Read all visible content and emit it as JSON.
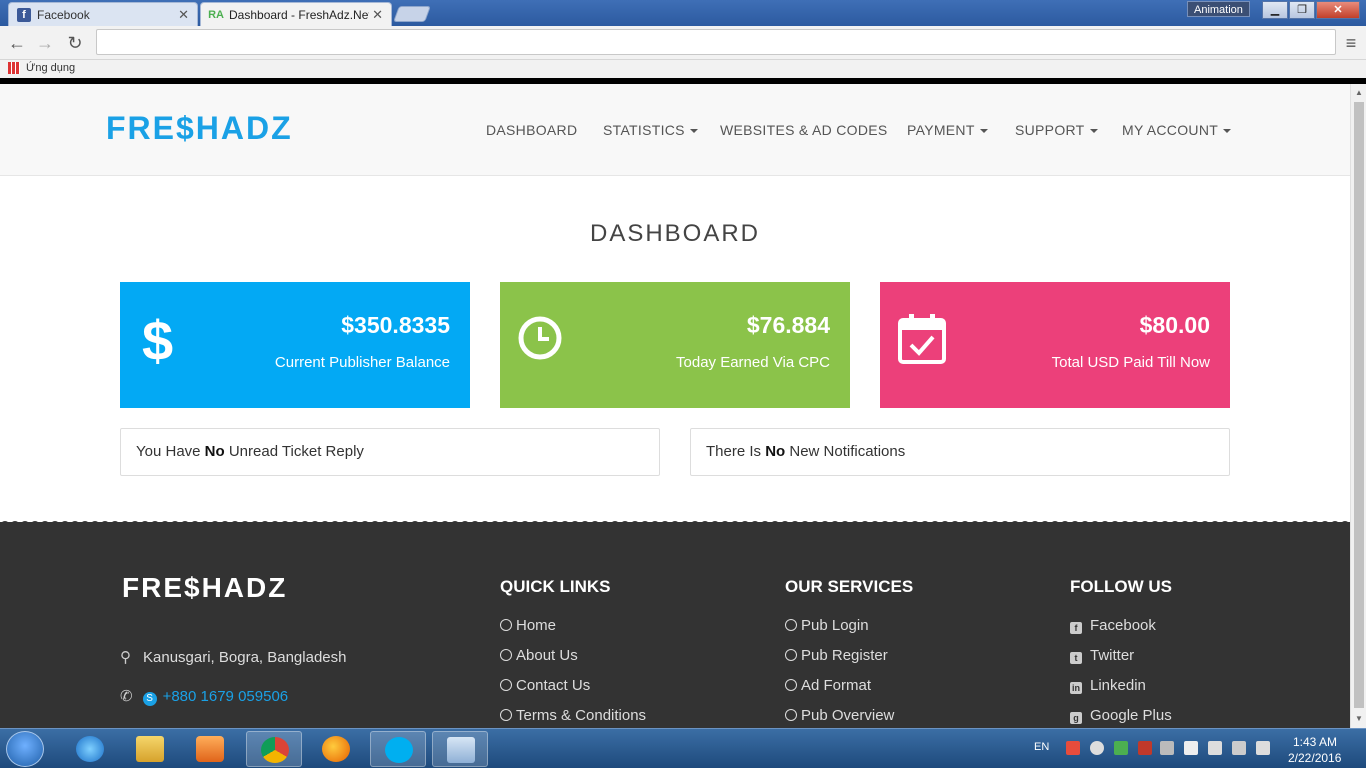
{
  "browser": {
    "tabs": [
      {
        "label": "Facebook",
        "active": false
      },
      {
        "label": "Dashboard - FreshAdz.Net",
        "active": true
      }
    ],
    "animation_badge": "Animation",
    "bookmarks_first": "Ứng dụng"
  },
  "site": {
    "logo": "FRE$HADZ",
    "nav": [
      {
        "label": "DASHBOARD",
        "dropdown": false
      },
      {
        "label": "STATISTICS",
        "dropdown": true
      },
      {
        "label": "WEBSITES & AD CODES",
        "dropdown": false
      },
      {
        "label": "PAYMENT",
        "dropdown": true
      },
      {
        "label": "SUPPORT",
        "dropdown": true
      },
      {
        "label": "MY ACCOUNT",
        "dropdown": true
      }
    ],
    "page_title": "DASHBOARD",
    "cards": [
      {
        "value": "$350.8335",
        "label": "Current Publisher Balance",
        "color": "#03a9f4",
        "icon": "dollar-icon"
      },
      {
        "value": "$76.884",
        "label": "Today Earned Via CPC",
        "color": "#8bc34a",
        "icon": "clock-icon"
      },
      {
        "value": "$80.00",
        "label": "Total USD Paid Till Now",
        "color": "#ec407a",
        "icon": "calendar-check-icon"
      }
    ],
    "notices": [
      {
        "pre": "You Have ",
        "bold": "No",
        "post": " Unread Ticket Reply"
      },
      {
        "pre": "There Is ",
        "bold": "No",
        "post": " New Notifications"
      }
    ]
  },
  "footer": {
    "logo": "FRE$HADZ",
    "address": "Kanusgari, Bogra, Bangladesh",
    "phone": "+880 1679 059506",
    "quick_links": {
      "heading": "QUICK LINKS",
      "items": [
        "Home",
        "About Us",
        "Contact Us",
        "Terms & Conditions"
      ]
    },
    "services": {
      "heading": "OUR SERVICES",
      "items": [
        "Pub Login",
        "Pub Register",
        "Ad Format",
        "Pub Overview"
      ]
    },
    "follow": {
      "heading": "FOLLOW US",
      "items": [
        "Facebook",
        "Twitter",
        "Linkedin",
        "Google Plus"
      ]
    }
  },
  "taskbar": {
    "lang": "EN",
    "time": "1:43 AM",
    "date": "2/22/2016"
  },
  "colors": {
    "brand": "#1aa1e6",
    "footer_bg": "#333333",
    "phone_link": "#1aa1e6"
  }
}
